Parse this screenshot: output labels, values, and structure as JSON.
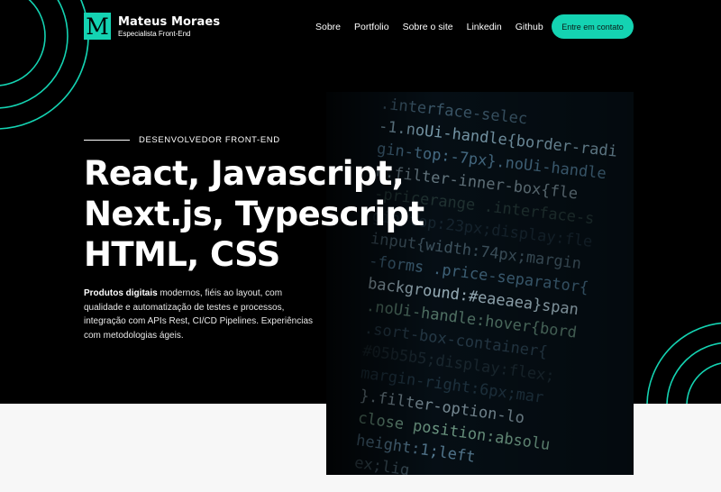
{
  "colors": {
    "accent": "#14d3b2",
    "hero_background": "#000000",
    "page_background": "#f7f7f7",
    "text": "#ffffff"
  },
  "header": {
    "logo_letter": "M",
    "brand_name": "Mateus Moraes",
    "brand_subtitle": "Especialista Front-End",
    "nav": [
      {
        "label": "Sobre"
      },
      {
        "label": "Portfolio"
      },
      {
        "label": "Sobre o site"
      },
      {
        "label": "Linkedin"
      },
      {
        "label": "Github"
      }
    ],
    "cta_label": "Entre em contato"
  },
  "hero": {
    "eyebrow": "DESENVOLVEDOR FRONT-END",
    "headline_lines": [
      "React, Javascript,",
      "Next.js, Typescript",
      "HTML, CSS"
    ],
    "description_bold": "Produtos digitais",
    "description_rest": " modernos, fiéis ao layout, com qualidade e automatização de testes e processos, integração com APIs Rest, CI/CD Pipelines. Experiências com metodologias ágeis."
  },
  "code_image": {
    "lines": [
      ".interface-selec",
      "-1.noUi-handle{border-radi",
      "gin-top:-7px}.noUi-handle",
      "n.filter-inner-box{fle",
      "-pricerange .interface-s",
      "gin-top:23px;display:fle",
      "input{width:74px;margin",
      "-forms .price-separator{",
      "background:#eaeaea}span",
      ".noUi-handle:hover{bord",
      ".sort-box-container{",
      "#05b5b5;display:flex;",
      "margin-right:6px;mar",
      "}.filter-option-lo",
      "close position:absolu",
      "height:1;left",
      "ex;lig"
    ]
  }
}
